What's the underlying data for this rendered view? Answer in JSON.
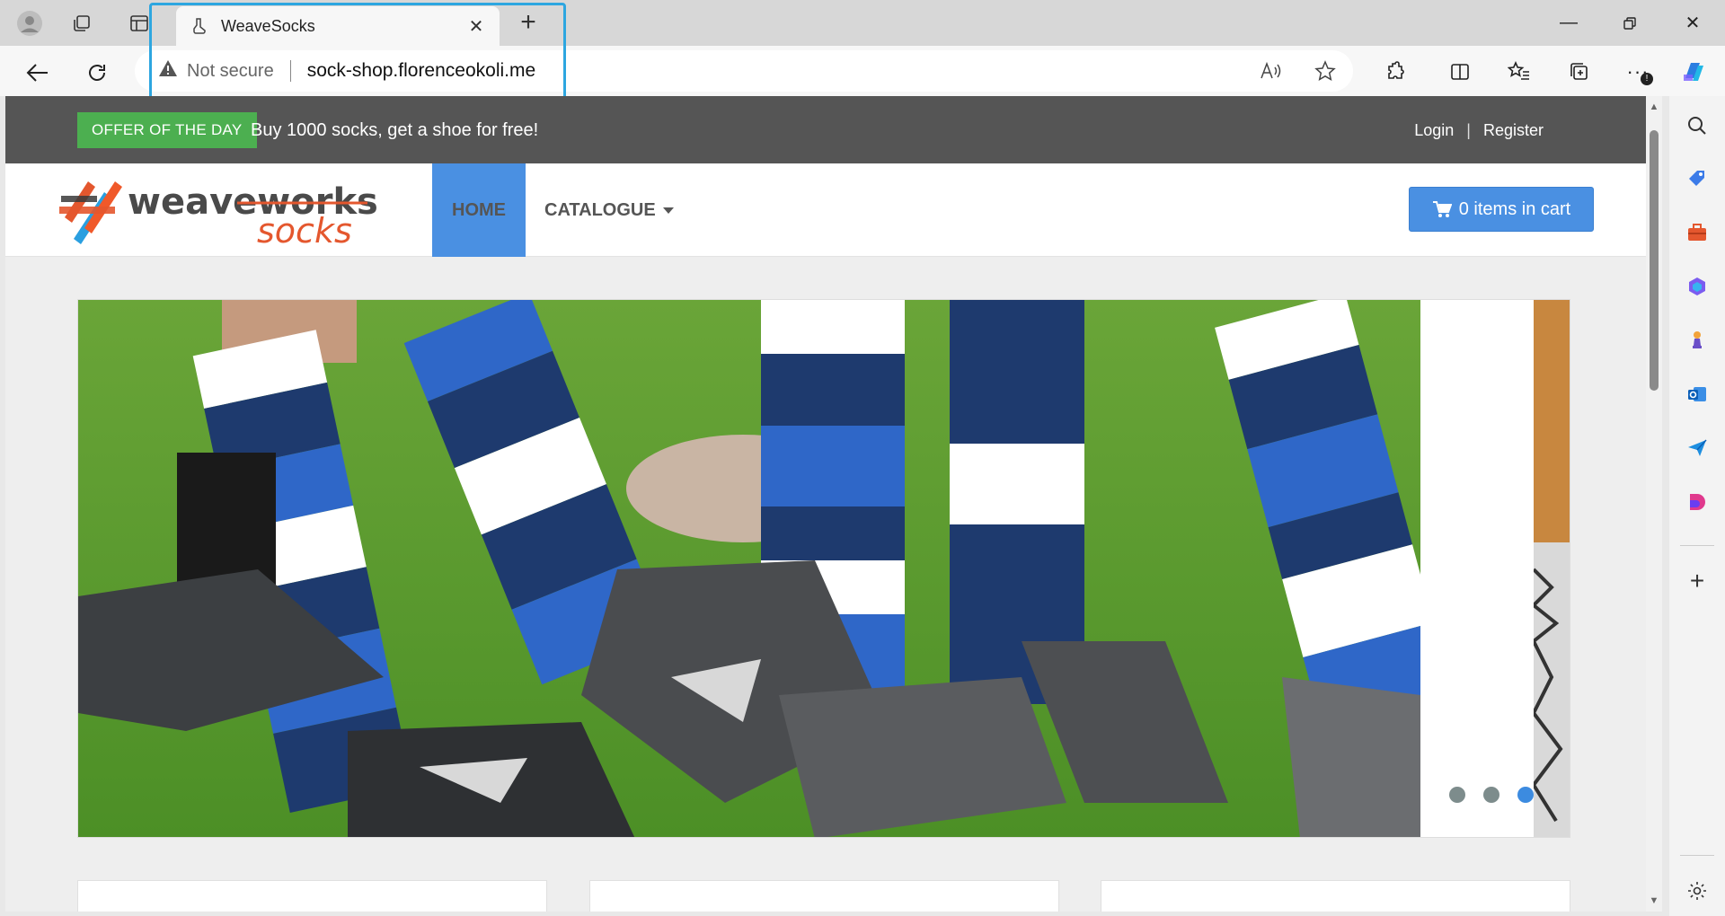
{
  "browser": {
    "tab": {
      "title": "WeaveSocks"
    },
    "address": {
      "security_label": "Not secure",
      "url": "sock-shop.florenceokoli.me"
    }
  },
  "site": {
    "offer": {
      "badge": "OFFER OF THE DAY",
      "text": "Buy 1000 socks, get a shoe for free!"
    },
    "auth": {
      "login": "Login",
      "separator": "|",
      "register": "Register"
    },
    "logo": {
      "line1": "weaveworks",
      "line2": "socks"
    },
    "nav": {
      "home": "HOME",
      "catalogue": "CATALOGUE"
    },
    "cart": {
      "label": "0 items in cart"
    },
    "carousel": {
      "slide_count": 3,
      "active_index": 2
    }
  },
  "colors": {
    "accent_blue": "#4a90e2",
    "offer_green": "#4caf50",
    "top_strip": "#555555",
    "highlight_box": "#2da6e0"
  }
}
